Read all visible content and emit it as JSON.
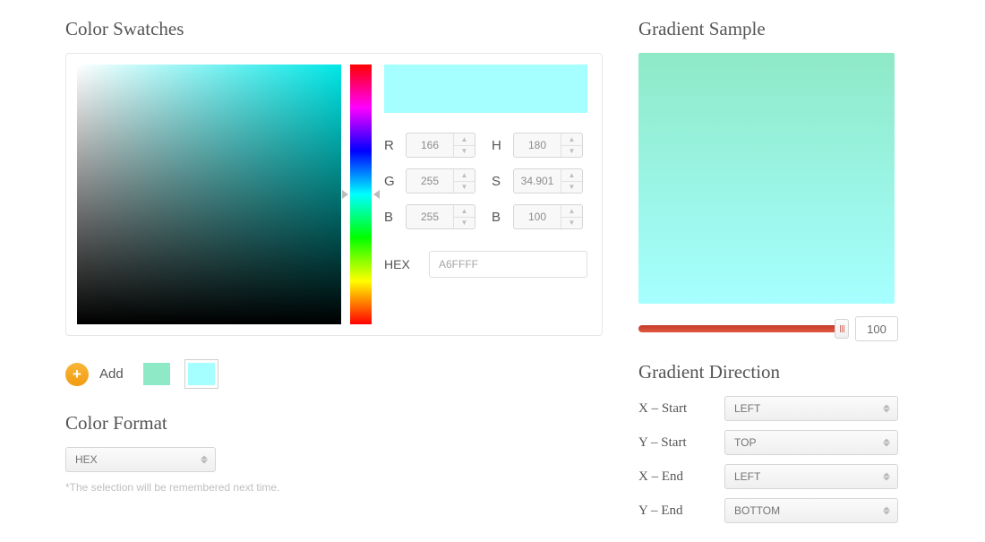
{
  "left": {
    "swatches_title": "Color Swatches",
    "rgb": {
      "r_label": "R",
      "g_label": "G",
      "b_label": "B",
      "r": "166",
      "g": "255",
      "b": "255"
    },
    "hsb": {
      "h_label": "H",
      "s_label": "S",
      "b_label": "B",
      "h": "180",
      "s": "34.901",
      "b": "100"
    },
    "hex": {
      "label": "HEX",
      "value": "A6FFFF"
    },
    "preview_color": "#A6FFFF",
    "add_label": "Add",
    "swatches": [
      {
        "color": "#8EE9C7",
        "selected": false
      },
      {
        "color": "#A6FFFF",
        "selected": true
      }
    ],
    "format_title": "Color Format",
    "format_value": "HEX",
    "format_hint": "*The selection will be remembered next time."
  },
  "right": {
    "sample_title": "Gradient Sample",
    "grad_from": "#8EE9C7",
    "grad_to": "#A6FFFF",
    "slider_value": "100",
    "direction_title": "Gradient Direction",
    "x_start_label": "X – Start",
    "y_start_label": "Y – Start",
    "x_end_label": "X – End",
    "y_end_label": "Y – End",
    "x_start": "LEFT",
    "y_start": "TOP",
    "x_end": "LEFT",
    "y_end": "BOTTOM"
  }
}
